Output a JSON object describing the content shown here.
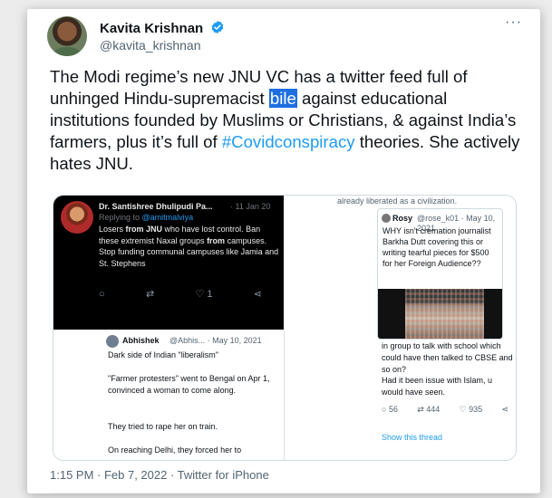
{
  "author": {
    "name": "Kavita Krishnan",
    "handle": "@kavita_krishnan"
  },
  "more": "···",
  "tweet": {
    "text_a": "The Modi regime’s new JNU VC has a twitter feed full of unhinged Hindu-supremacist ",
    "highlight": "bile",
    "text_b": " against educational institutions founded by Muslims or Christians, & against India’s farmers, plus it’s full of ",
    "hashtag": "#Covidconspiracy",
    "text_c": " theories. She actively hates JNU."
  },
  "media": {
    "dark_tweet": {
      "name": "Dr. Santishree Dhulipudi Pa...",
      "date": "· 11 Jan 20",
      "replying_prefix": "Replying to ",
      "replying_handle": "@amitmalviya",
      "body_1": "Losers ",
      "body_from1": "from",
      "body_jnu": " JNU",
      "body_2": " who have lost control. Ban these extremist Naxal groups ",
      "body_from2": "from",
      "body_3": " campuses. Stop funding communal campuses like Jamia and St. Stephens",
      "reply_icon": "○",
      "retweet_icon": "⇄",
      "like": "♡ 1",
      "share_icon": "⋖"
    },
    "abhishek": {
      "name": "Abhishek",
      "meta": "@Abhis... · May 10, 2021",
      "line1": "Dark side of Indian \"liberalism\"",
      "line2": "\"Farmer protesters\" went to Bengal on Apr 1, convinced a woman to come along.",
      "line3": "They tried to rape her on train.",
      "line4": "On reaching Delhi, they forced her to"
    },
    "right": {
      "top_text": "already liberated as a civilization.",
      "quote": {
        "name": "Rosy",
        "meta": "@rose_k01 · May 10, 2021",
        "body": "WHY isn't cremation journalist Barkha Dutt covering this or writing tearful pieces for $500  for her Foreign Audience??"
      },
      "line1": "in group to talk with school which could have then talked to CBSE and so on?",
      "line2": "Had it been issue with Islam, u would have seen.",
      "replies": "56",
      "retweets": "444",
      "likes": "935",
      "show_thread": "Show this thread"
    }
  },
  "timestamp": "1:15 PM · Feb 7, 2022 · Twitter for iPhone"
}
